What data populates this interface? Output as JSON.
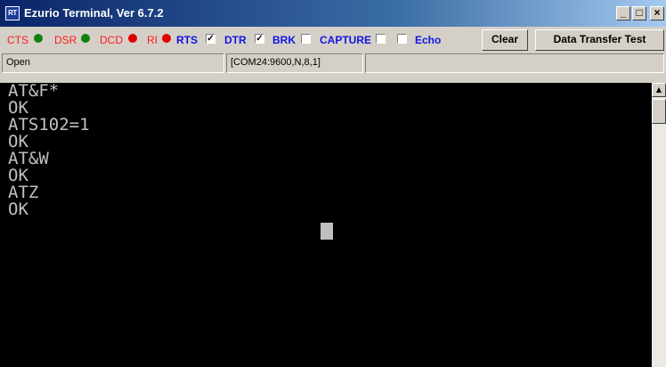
{
  "window": {
    "icon_text": "RT",
    "title": "Ezurio Terminal, Ver 6.7.2",
    "minimize": "_",
    "maximize": "□",
    "close": "×"
  },
  "toolbar": {
    "cts": "CTS",
    "dsr": "DSR",
    "dcd": "DCD",
    "ri": "RI",
    "rts": "RTS",
    "dtr": "DTR",
    "brk": "BRK",
    "capture": "CAPTURE",
    "echo": "Echo",
    "clear": "Clear",
    "data_transfer_test": "Data Transfer Test",
    "checked_mark": "✓",
    "rts_checked": true,
    "dtr_checked": true,
    "brk_checked": false,
    "capture_checked": false,
    "echo_checked": false
  },
  "status": {
    "state": "Open",
    "port": "[COM24:9600,N,8,1]"
  },
  "terminal": {
    "lines": [
      "AT&F*",
      "OK",
      "ATS102=1",
      "OK",
      "AT&W",
      "OK",
      "ATZ",
      "OK"
    ]
  },
  "colors": {
    "signal_label": "#ff1a1a",
    "control_label": "#1414e0",
    "led_green": "#108010",
    "led_red": "#e00000",
    "terminal_bg": "#000000",
    "terminal_text": "#c0c0c0"
  },
  "icons": {
    "app": "terminal-app-icon",
    "scroll_up": "scroll-up-arrow-icon"
  }
}
